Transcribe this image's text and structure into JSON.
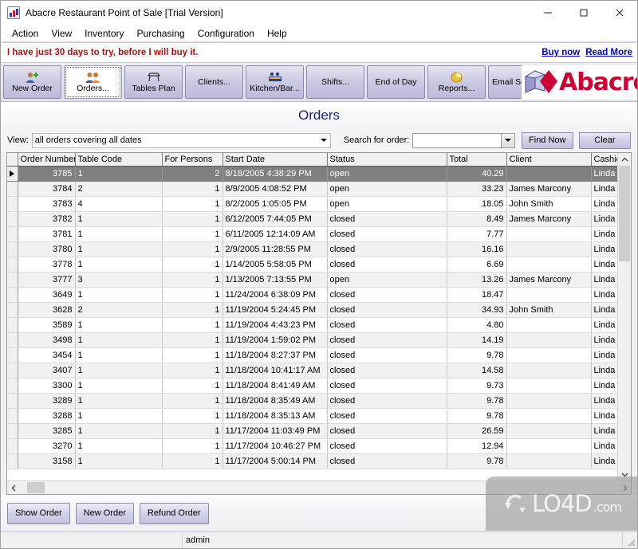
{
  "window": {
    "title": "Abacre Restaurant Point of Sale [Trial Version]",
    "minimize_label": "—",
    "maximize_label": "□",
    "close_label": "✕"
  },
  "menu": {
    "items": [
      {
        "label": "Action"
      },
      {
        "label": "View"
      },
      {
        "label": "Inventory"
      },
      {
        "label": "Purchasing"
      },
      {
        "label": "Configuration"
      },
      {
        "label": "Help"
      }
    ]
  },
  "trial": {
    "message": "I have just 30 days to try, before I will buy it.",
    "buy_now": "Buy now",
    "read_more": "Read More",
    "text_color": "#b01010",
    "link_color": "#0000cc"
  },
  "toolbar": {
    "buttons": [
      {
        "label": "New Order",
        "icon": "user-add-icon",
        "selected": false
      },
      {
        "label": "Orders...",
        "icon": "users-icon",
        "selected": true
      },
      {
        "label": "Tables Plan",
        "icon": "table-plan-icon",
        "selected": false
      },
      {
        "label": "Clients...",
        "icon": "",
        "selected": false
      },
      {
        "label": "Kitchen/Bar...",
        "icon": "kitchen-bar-icon",
        "selected": false
      },
      {
        "label": "Shifts...",
        "icon": "",
        "selected": false
      },
      {
        "label": "End of Day",
        "icon": "",
        "selected": false
      },
      {
        "label": "Reports...",
        "icon": "reports-icon",
        "selected": false
      },
      {
        "label": "Email Sender",
        "icon": "",
        "selected": false
      }
    ],
    "logo_text": "Abacre",
    "logo_color": "#cc0033"
  },
  "page": {
    "title": "Orders",
    "title_color": "#202080"
  },
  "filters": {
    "view_label": "View:",
    "view_value": "all orders covering all dates",
    "search_label": "Search for order:",
    "search_value": "",
    "search_placeholder": "",
    "find_now_label": "Find Now",
    "clear_label": "Clear"
  },
  "grid": {
    "columns": [
      "Order Number",
      "Table Code",
      "For Persons",
      "Start Date",
      "Status",
      "Total",
      "Client",
      "Cashier"
    ],
    "rows": [
      {
        "order_number": "3785",
        "table_code": "1",
        "for_persons": "2",
        "start_date": "8/18/2005 4:38:29 PM",
        "status": "open",
        "total": "40.29",
        "client": "",
        "cashier": "Linda Th",
        "selected": true
      },
      {
        "order_number": "3784",
        "table_code": "2",
        "for_persons": "1",
        "start_date": "8/9/2005 4:08:52 PM",
        "status": "open",
        "total": "33.23",
        "client": "James Marcony",
        "cashier": "Linda Th",
        "selected": false
      },
      {
        "order_number": "3783",
        "table_code": "4",
        "for_persons": "1",
        "start_date": "8/2/2005 1:05:05 PM",
        "status": "open",
        "total": "18.05",
        "client": "John Smith",
        "cashier": "Linda Th",
        "selected": false
      },
      {
        "order_number": "3782",
        "table_code": "1",
        "for_persons": "1",
        "start_date": "6/12/2005 7:44:05 PM",
        "status": "closed",
        "total": "8.49",
        "client": "James Marcony",
        "cashier": "Linda Th",
        "selected": false
      },
      {
        "order_number": "3781",
        "table_code": "1",
        "for_persons": "1",
        "start_date": "6/11/2005 12:14:09 AM",
        "status": "closed",
        "total": "7.77",
        "client": "",
        "cashier": "Linda Th",
        "selected": false
      },
      {
        "order_number": "3780",
        "table_code": "1",
        "for_persons": "1",
        "start_date": "2/9/2005 11:28:55 PM",
        "status": "closed",
        "total": "16.16",
        "client": "",
        "cashier": "Linda Th",
        "selected": false
      },
      {
        "order_number": "3778",
        "table_code": "1",
        "for_persons": "1",
        "start_date": "1/14/2005 5:58:05 PM",
        "status": "closed",
        "total": "6.69",
        "client": "",
        "cashier": "Linda Th",
        "selected": false
      },
      {
        "order_number": "3777",
        "table_code": "3",
        "for_persons": "1",
        "start_date": "1/13/2005 7:13:55 PM",
        "status": "open",
        "total": "13.26",
        "client": "James Marcony",
        "cashier": "Linda Th",
        "selected": false
      },
      {
        "order_number": "3649",
        "table_code": "1",
        "for_persons": "1",
        "start_date": "11/24/2004 6:38:09 PM",
        "status": "closed",
        "total": "18.47",
        "client": "",
        "cashier": "Linda Th",
        "selected": false
      },
      {
        "order_number": "3628",
        "table_code": "2",
        "for_persons": "1",
        "start_date": "11/19/2004 5:24:45 PM",
        "status": "closed",
        "total": "34.93",
        "client": "John Smith",
        "cashier": "Linda Th",
        "selected": false
      },
      {
        "order_number": "3589",
        "table_code": "1",
        "for_persons": "1",
        "start_date": "11/19/2004 4:43:23 PM",
        "status": "closed",
        "total": "4.80",
        "client": "",
        "cashier": "Linda Th",
        "selected": false
      },
      {
        "order_number": "3498",
        "table_code": "1",
        "for_persons": "1",
        "start_date": "11/19/2004 1:59:02 PM",
        "status": "closed",
        "total": "14.19",
        "client": "",
        "cashier": "Linda Th",
        "selected": false
      },
      {
        "order_number": "3454",
        "table_code": "1",
        "for_persons": "1",
        "start_date": "11/18/2004 8:27:37 PM",
        "status": "closed",
        "total": "9.78",
        "client": "",
        "cashier": "Linda Th",
        "selected": false
      },
      {
        "order_number": "3407",
        "table_code": "1",
        "for_persons": "1",
        "start_date": "11/18/2004 10:41:17 AM",
        "status": "closed",
        "total": "14.58",
        "client": "",
        "cashier": "Linda Th",
        "selected": false
      },
      {
        "order_number": "3300",
        "table_code": "1",
        "for_persons": "1",
        "start_date": "11/18/2004 8:41:49 AM",
        "status": "closed",
        "total": "9.73",
        "client": "",
        "cashier": "Linda Th",
        "selected": false
      },
      {
        "order_number": "3289",
        "table_code": "1",
        "for_persons": "1",
        "start_date": "11/18/2004 8:35:49 AM",
        "status": "closed",
        "total": "9.78",
        "client": "",
        "cashier": "Linda Th",
        "selected": false
      },
      {
        "order_number": "3288",
        "table_code": "1",
        "for_persons": "1",
        "start_date": "11/18/2004 8:35:13 AM",
        "status": "closed",
        "total": "9.78",
        "client": "",
        "cashier": "Linda Th",
        "selected": false
      },
      {
        "order_number": "3285",
        "table_code": "1",
        "for_persons": "1",
        "start_date": "11/17/2004 11:03:49 PM",
        "status": "closed",
        "total": "26.59",
        "client": "",
        "cashier": "Linda Th",
        "selected": false
      },
      {
        "order_number": "3270",
        "table_code": "1",
        "for_persons": "1",
        "start_date": "11/17/2004 10:46:27 PM",
        "status": "closed",
        "total": "12.94",
        "client": "",
        "cashier": "Linda Th",
        "selected": false
      },
      {
        "order_number": "3158",
        "table_code": "1",
        "for_persons": "1",
        "start_date": "11/17/2004 5:00:14 PM",
        "status": "closed",
        "total": "9.78",
        "client": "",
        "cashier": "Linda Th",
        "selected": false
      }
    ]
  },
  "actions": {
    "show_order": "Show Order",
    "new_order": "New Order",
    "refund_order": "Refund Order"
  },
  "status": {
    "left": "",
    "user": "admin"
  },
  "watermark": {
    "brand": "LO4D",
    "suffix": ".com"
  }
}
